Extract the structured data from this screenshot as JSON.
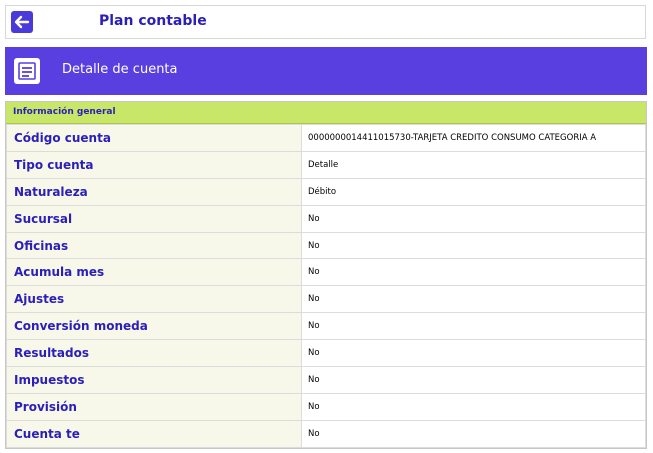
{
  "app": {
    "title": "Plan contable"
  },
  "section": {
    "title": "Detalle de cuenta"
  },
  "group": {
    "title": "Información general"
  },
  "rows": [
    {
      "label": "Código cuenta",
      "value": "0000000014411015730-TARJETA CREDITO CONSUMO CATEGORIA A"
    },
    {
      "label": "Tipo cuenta",
      "value": "Detalle"
    },
    {
      "label": "Naturaleza",
      "value": "Débito"
    },
    {
      "label": "Sucursal",
      "value": "No"
    },
    {
      "label": "Oficinas",
      "value": "No"
    },
    {
      "label": "Acumula mes",
      "value": "No"
    },
    {
      "label": "Ajustes",
      "value": "No"
    },
    {
      "label": "Conversión moneda",
      "value": "No"
    },
    {
      "label": "Resultados",
      "value": "No"
    },
    {
      "label": "Impuestos",
      "value": "No"
    },
    {
      "label": "Provisión",
      "value": "No"
    },
    {
      "label": "Cuenta te",
      "value": "No"
    }
  ],
  "colors": {
    "accent": "#5a3fe0",
    "group_header": "#c8e667",
    "label_text": "#2a1fb8"
  },
  "icons": {
    "back": "arrow-left-icon",
    "section": "document-icon"
  }
}
